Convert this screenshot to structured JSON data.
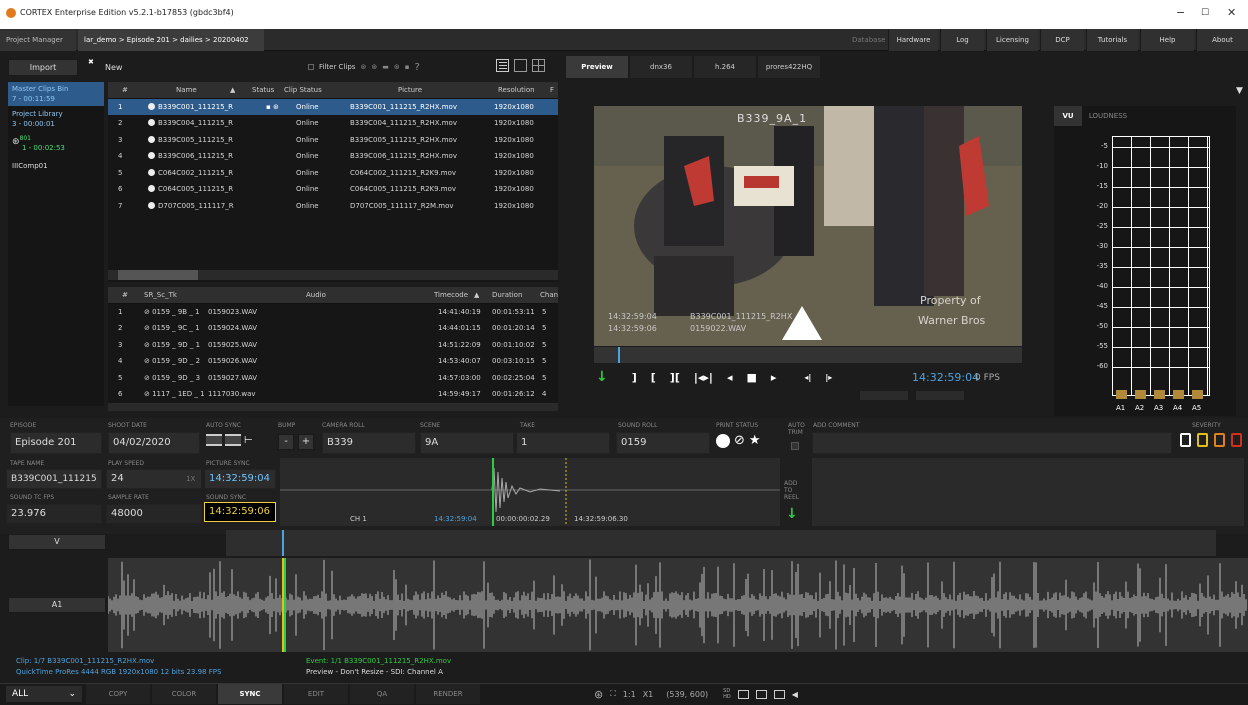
{
  "window": {
    "title": "CORTEX Enterprise Edition v5.2.1-b17853 (gbdc3bf4)",
    "min": "−",
    "max": "☐",
    "close": "✕"
  },
  "menu": {
    "tabs": [
      "Project Manager",
      "lar_demo > Episode 201 > dailies > 20200402"
    ],
    "tab_close": "✖",
    "right": [
      "Database",
      "Hardware",
      "Log",
      "Licensing",
      "DCP",
      "Tutorials",
      "Help",
      "About"
    ]
  },
  "toolbar": {
    "import": "Import",
    "new": "New",
    "filter": "Filter Clips",
    "help": "?"
  },
  "bins": {
    "items": [
      {
        "l1": "Master Clips Bin",
        "l2": "7 - 00:11:59"
      },
      {
        "l1": "Project Library",
        "l2": "3 - 00:00:01"
      },
      {
        "l1": "801",
        "l2": "1 - 00:02:53"
      },
      {
        "l1": "Comp01",
        "l2": ""
      }
    ]
  },
  "clips": {
    "headers": [
      "#",
      "Name",
      "Status",
      "Clip Status",
      "Picture",
      "Resolution",
      "F"
    ],
    "rows": [
      {
        "n": "1",
        "name": "B339C001_111215_R",
        "status": "Online",
        "picture": "B339C001_111215_R2HX.mov",
        "res": "1920x1080"
      },
      {
        "n": "2",
        "name": "B339C004_111215_R",
        "status": "Online",
        "picture": "B339C004_111215_R2HX.mov",
        "res": "1920x1080"
      },
      {
        "n": "3",
        "name": "B339C005_111215_R",
        "status": "Online",
        "picture": "B339C005_111215_R2HX.mov",
        "res": "1920x1080"
      },
      {
        "n": "4",
        "name": "B339C006_111215_R",
        "status": "Online",
        "picture": "B339C006_111215_R2HX.mov",
        "res": "1920x1080"
      },
      {
        "n": "5",
        "name": "C064C002_111215_R",
        "status": "Online",
        "picture": "C064C002_111215_R2K9.mov",
        "res": "1920x1080"
      },
      {
        "n": "6",
        "name": "C064C005_111215_R",
        "status": "Online",
        "picture": "C064C005_111215_R2K9.mov",
        "res": "1920x1080"
      },
      {
        "n": "7",
        "name": "D707C005_111117_R",
        "status": "Online",
        "picture": "D707C005_111117_R2M.mov",
        "res": "1920x1080"
      }
    ]
  },
  "audio": {
    "headers": [
      "#",
      "SR_Sc_Tk",
      "Audio",
      "Timecode",
      "Duration",
      "Chan"
    ],
    "rows": [
      {
        "n": "1",
        "sc": "⊘ 0159 _ 9B _ 1",
        "file": "0159023.WAV",
        "tc": "14:41:40:19",
        "dur": "00:01:53:11",
        "ch": "5"
      },
      {
        "n": "2",
        "sc": "⊘ 0159 _ 9C _ 1",
        "file": "0159024.WAV",
        "tc": "14:44:01:15",
        "dur": "00:01:20:14",
        "ch": "5"
      },
      {
        "n": "3",
        "sc": "⊘ 0159 _ 9D _ 1",
        "file": "0159025.WAV",
        "tc": "14:51:22:09",
        "dur": "00:01:10:02",
        "ch": "5"
      },
      {
        "n": "4",
        "sc": "⊘ 0159 _ 9D _ 2",
        "file": "0159026.WAV",
        "tc": "14:53:40:07",
        "dur": "00:03:10:15",
        "ch": "5"
      },
      {
        "n": "5",
        "sc": "⊘ 0159 _ 9D _ 3",
        "file": "0159027.WAV",
        "tc": "14:57:03:00",
        "dur": "00:02:25:04",
        "ch": "5"
      },
      {
        "n": "6",
        "sc": "⊘ 1117 _ 1ED _ 1",
        "file": "1117030.wav",
        "tc": "14:59:49:17",
        "dur": "00:01:26:12",
        "ch": "4"
      }
    ]
  },
  "preview": {
    "tabs": [
      "Preview",
      "dnx36",
      "h.264",
      "prores422HQ"
    ],
    "burn_top": "B339_9A_1",
    "burn_tc1": "14:32:59:04",
    "burn_tc2": "14:32:59:06",
    "burn_clip": "B339C001_111215_R2HX",
    "burn_wav": "0159022.WAV",
    "watermark1": "Property of",
    "watermark2": "Warner Bros",
    "slate": "B339 9A 1",
    "tc": "14:32:59:04",
    "fps": "0 FPS",
    "menu_arrow": "▼"
  },
  "meters": {
    "tabs": [
      "VU",
      "LOUDNESS"
    ],
    "scale": [
      "-5",
      "-10",
      "-15",
      "-20",
      "-25",
      "-30",
      "-35",
      "-40",
      "-45",
      "-50",
      "-55",
      "-60"
    ],
    "channels": [
      "A1",
      "A2",
      "A3",
      "A4",
      "A5"
    ]
  },
  "fields": {
    "episode_l": "EPISODE",
    "episode": "Episode 201",
    "shoot_l": "SHOOT DATE",
    "shoot": "04/02/2020",
    "autosync_l": "AUTO SYNC",
    "bump_l": "BUMP",
    "roll_l": "CAMERA ROLL",
    "roll": "B339",
    "scene_l": "SCENE",
    "scene": "9A",
    "take_l": "TAKE",
    "take": "1",
    "sound_l": "SOUND ROLL",
    "sound": "0159",
    "print_l": "PRINT STATUS",
    "auto_l": "AUTO TRIM",
    "comment_l": "ADD COMMENT",
    "severity_l": "SEVERITY",
    "tape_l": "TAPE NAME",
    "tape": "B339C001_111215",
    "speed_l": "PLAY SPEED",
    "speed": "24",
    "speed_x": "1X",
    "psync_l": "PICTURE SYNC",
    "psync": "14:32:59:04",
    "fps_l": "SOUND TC FPS",
    "fps": "23.976",
    "rate_l": "SAMPLE RATE",
    "rate": "48000",
    "ssync_l": "SOUND SYNC",
    "ssync": "14:32:59:06",
    "add_reel": "ADD TO REEL",
    "minus": "-",
    "plus": "+"
  },
  "wave": {
    "ch": "CH 1",
    "tc1": "14:32:59:04",
    "off": "00:00:00:02.29",
    "tc2": "14:32:59:06.30"
  },
  "tracks": {
    "v": "V",
    "a": "A1"
  },
  "status": {
    "clip": "Clip: 1/7  B339C001_111215_R2HX.mov",
    "fmt": "QuickTime  ProRes 4444 RGB  1920x1080  12 bits  23.98 FPS",
    "event": "Event: 1/1  B339C001_111215_R2HX.mov",
    "prev": "Preview - Don't Resize - SDI: Channel A"
  },
  "bottom": {
    "filter": "ALL",
    "tabs": [
      "COPY",
      "COLOR",
      "SYNC",
      "EDIT",
      "QA",
      "RENDER"
    ],
    "zoom": "1:1",
    "x": "X1",
    "coords": "(539, 600)",
    "sd": "SD",
    "hd": "HD"
  },
  "colors": {
    "accent": "#4da3e0",
    "green": "#2ecc40",
    "yellow": "#e0c020",
    "orange": "#e08020",
    "red": "#d03020",
    "selected": "#2d5c8c"
  }
}
